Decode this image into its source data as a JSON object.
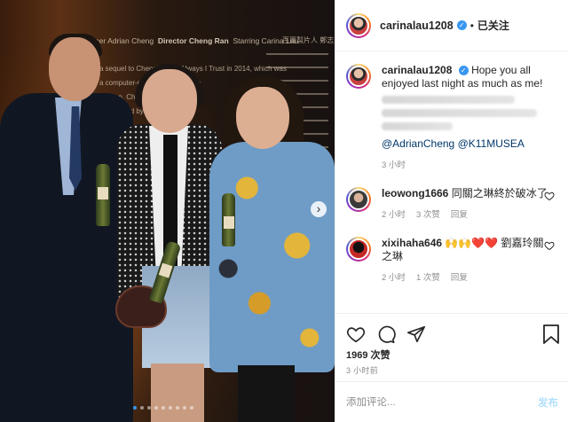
{
  "photo": {
    "poster": {
      "credits": [
        "ducer Adrian Cheng",
        "Director Cheng Ran",
        "Starring Carina Lau"
      ],
      "cjk_header": "百周製片人 鄭志",
      "lines": [
        "a sequel to Cheng's work Always I Trust in 2014, which was",
        "a computer-gene       cail sent to the",
        "woman, Cheng co       o the sub",
        "xperienced by cit",
        "aken from",
        "uto-nen"
      ]
    },
    "carousel": {
      "total_dots": 9,
      "active_index": 0
    }
  },
  "post": {
    "author": "carinalau1208",
    "header_separator": "•",
    "follow_label": "已关注",
    "caption": {
      "username": "carinalau1208",
      "text": "Hope you all enjoyed last night as much as me!",
      "mentions": "@AdrianCheng @K11MUSEA",
      "time": "3 小时"
    },
    "comments": [
      {
        "username": "leowong1666",
        "text": "同關之琳終於破冰了",
        "time": "2 小时",
        "likes": "3 次赞",
        "reply": "回复"
      },
      {
        "username": "xixihaha646",
        "emoji": "🙌🙌❤️❤️",
        "text": "劉嘉玲關之琳",
        "time": "2 小时",
        "likes": "1 次赞",
        "reply": "回复"
      }
    ],
    "likes_count": "1969 次赞",
    "posted_ago": "3 小时前",
    "add_comment_placeholder": "添加评论...",
    "post_button": "发布"
  },
  "colors": {
    "link": "#00376b",
    "verified": "#3897f0",
    "muted": "#8e8e8e",
    "post_disabled": "#b2dffc"
  }
}
